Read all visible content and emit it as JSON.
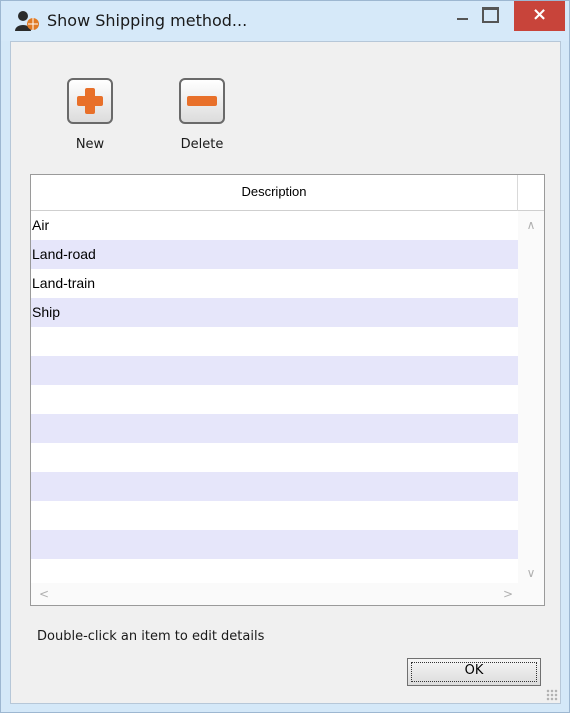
{
  "window": {
    "title": "Show Shipping method...",
    "minimize_glyph": "",
    "close_glyph": "×"
  },
  "toolbar": {
    "new_label": "New",
    "delete_label": "Delete"
  },
  "table": {
    "column_header": "Description",
    "rows": [
      "Air",
      "Land-road",
      "Land-train",
      "Ship",
      "",
      "",
      "",
      "",
      "",
      "",
      "",
      "",
      ""
    ]
  },
  "footer": {
    "hint": "Double-click an item to edit details",
    "ok_label": "OK"
  },
  "colors": {
    "title_bar": "#d6e9f9",
    "close_button": "#c8443a",
    "row_alt": "#e6e6fa",
    "plus_icon": "#e8702a",
    "minus_icon": "#e8702a"
  },
  "icons": {
    "app": "user-globe-icon",
    "new": "plus-icon",
    "delete": "minus-icon"
  }
}
